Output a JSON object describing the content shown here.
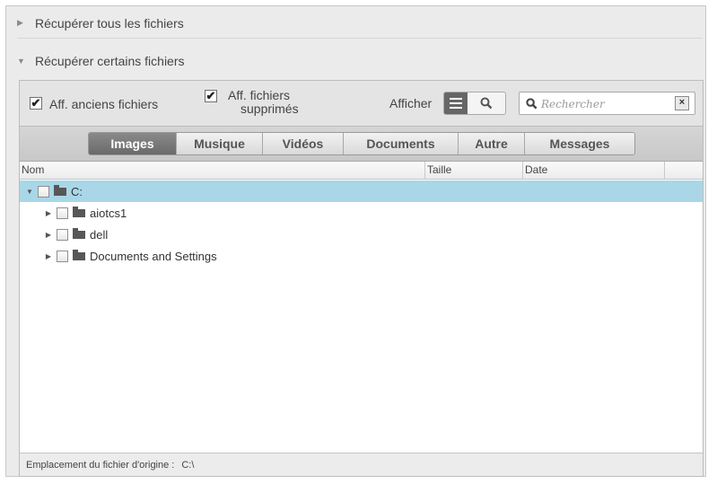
{
  "sections": {
    "all_files_label": "Récupérer tous les fichiers",
    "some_files_label": "Récupérer certains fichiers"
  },
  "options": {
    "show_old_files": {
      "label": "Aff. anciens fichiers",
      "checked": true
    },
    "show_deleted_files": {
      "label_line1": "Aff. fichiers",
      "label_line2": "supprimés",
      "checked": true
    },
    "view_label": "Afficher",
    "search_placeholder": "Rechercher"
  },
  "tabs": [
    {
      "label": "Images",
      "active": true
    },
    {
      "label": "Musique",
      "active": false
    },
    {
      "label": "Vidéos",
      "active": false
    },
    {
      "label": "Documents",
      "active": false
    },
    {
      "label": "Autre",
      "active": false
    },
    {
      "label": "Messages",
      "active": false
    }
  ],
  "table": {
    "columns": [
      "Nom",
      "Taille",
      "Date"
    ],
    "rows": [
      {
        "name": "C:",
        "level": 0,
        "expanded": true,
        "selected": true
      },
      {
        "name": "aiotcs1",
        "level": 1,
        "expanded": false,
        "selected": false
      },
      {
        "name": "dell",
        "level": 1,
        "expanded": false,
        "selected": false
      },
      {
        "name": "Documents and Settings",
        "level": 1,
        "expanded": false,
        "selected": false
      }
    ]
  },
  "footer": {
    "label": "Emplacement du fichier d'origine :",
    "value": "C:\\"
  },
  "icons": {
    "collapsed": "triangle-right-icon",
    "expanded": "triangle-down-icon",
    "folder": "folder-icon",
    "search": "magnifier-icon",
    "clear": "close-icon",
    "list_view": "list-view-icon"
  },
  "colors": {
    "selected_row": "#a9d7e7",
    "active_tab": "#7a7a7a"
  }
}
